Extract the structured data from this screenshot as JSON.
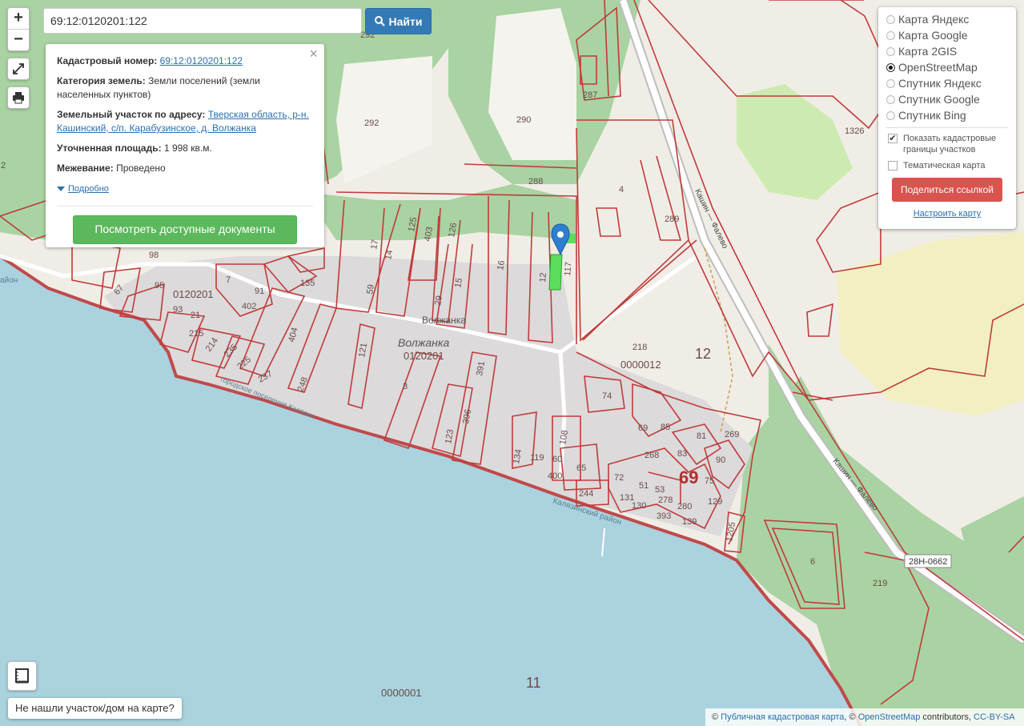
{
  "search": {
    "value": "69:12:0120201:122",
    "button": "Найти"
  },
  "zoom": {
    "in": "+",
    "out": "−"
  },
  "info": {
    "cad_label": "Кадастровый номер:",
    "cad_value": "69:12:0120201:122",
    "cat_label": "Категория земель:",
    "cat_value": "Земли поселений (земли населенных пунктов)",
    "addr_label": "Земельный участок по адресу:",
    "addr_value": "Тверская область, р-н. Кашинский, с/п. Карабузинское, д. Волжанка",
    "area_label": "Уточненная площадь:",
    "area_value": "1 998 кв.м.",
    "mezh_label": "Межевание:",
    "mezh_value": "Проведено",
    "more": "Подробно",
    "docs_button": "Посмотреть доступные документы"
  },
  "layers": {
    "items": [
      {
        "label": "Карта Яндекс",
        "selected": false
      },
      {
        "label": "Карта Google",
        "selected": false
      },
      {
        "label": "Карта 2GIS",
        "selected": false
      },
      {
        "label": "OpenStreetMap",
        "selected": true
      },
      {
        "label": "Спутник Яндекс",
        "selected": false
      },
      {
        "label": "Спутник Google",
        "selected": false
      },
      {
        "label": "Спутник Bing",
        "selected": false
      }
    ],
    "show_borders": "Показать кадастровые границы участков",
    "thematic": "Тематическая карта",
    "share": "Поделиться ссылкой",
    "configure": "Настроить карту"
  },
  "notfound": "Не нашли участок/дом на карте?",
  "attribution": {
    "copy1": "©",
    "link1": "Публичная кадастровая карта",
    "copy2": ", ©",
    "link2": "OpenStreetMap",
    "mid": "contributors,",
    "link3": "CC-BY-SA"
  },
  "map_labels": {
    "village": "Волжанка",
    "village_road": "Волжанка",
    "block_code": "0120201",
    "block_code2": "0120201",
    "q12": "0000012",
    "q1": "0000001",
    "n12": "12",
    "n11": "11",
    "n69": "69",
    "road_name": "Кашин — Фалево",
    "road_name2": "Кашин — Фалево",
    "road_code": "28Н-0662",
    "district": "Калязинский район",
    "town_left": "городское поселение Калязин",
    "parcels": {
      "p287": "287",
      "p292": "292",
      "p292b": "292",
      "p290": "290",
      "p288": "288",
      "p289": "289",
      "p1326": "1326",
      "p218": "218",
      "p74": "74",
      "p85": "85",
      "p69": "69",
      "p81": "81",
      "p269": "269",
      "p83": "83",
      "p90": "90",
      "p75": "75",
      "p268": "268",
      "p72": "72",
      "p53": "53",
      "p51": "51",
      "p131": "131",
      "p130": "130",
      "p278": "278",
      "p393": "393",
      "p280": "280",
      "p139": "139",
      "p129": "129",
      "p1205": "1205",
      "p6": "6",
      "p219": "219",
      "p65": "65",
      "p244": "244",
      "p400": "400",
      "p60": "60",
      "p108": "108",
      "p119": "119",
      "p134": "134",
      "p391": "391",
      "p396": "396",
      "p123": "123",
      "p3": "3",
      "p121": "121",
      "p404": "404",
      "p248": "248",
      "p237": "237",
      "p225": "225",
      "p235": "235",
      "p214": "214",
      "p215": "215",
      "p21": "21",
      "p93": "93",
      "p95": "95",
      "p67": "67",
      "p98": "98",
      "p7": "7",
      "p402": "402",
      "p91": "91",
      "p135": "135",
      "p17": "17",
      "p14": "14",
      "p125": "125",
      "p403": "403",
      "p126": "126",
      "p59": "59",
      "p29": "29",
      "p15": "15",
      "p16": "16",
      "p12": "12",
      "p117": "117",
      "p2": "2",
      "p4": "4"
    },
    "edge_label": "айон"
  }
}
